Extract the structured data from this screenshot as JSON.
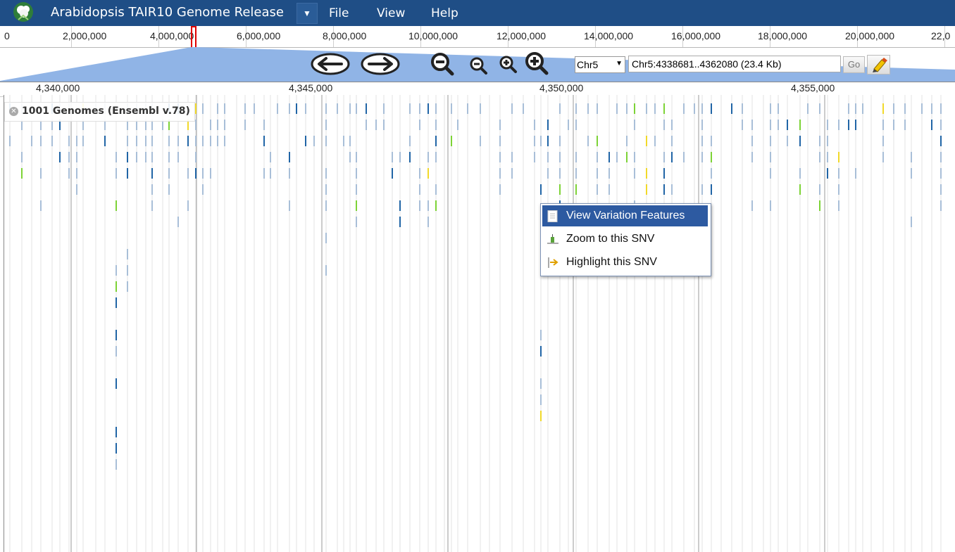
{
  "app": {
    "title": "Arabidopsis TAIR10 Genome Release",
    "menus": [
      "File",
      "View",
      "Help"
    ]
  },
  "overview": {
    "labels": [
      "0",
      "2,000,000",
      "4,000,000",
      "6,000,000",
      "8,000,000",
      "10,000,000",
      "12,000,000",
      "14,000,000",
      "16,000,000",
      "18,000,000",
      "20,000,000",
      "22,0"
    ]
  },
  "navigation": {
    "chromosome": "Chr5",
    "location": "Chr5:4338681..4362080 (23.4 Kb)",
    "go_label": "Go"
  },
  "ruler": {
    "labels": [
      "4,340,000",
      "4,345,000",
      "4,350,000",
      "4,355,000"
    ]
  },
  "track": {
    "label": "1001 Genomes (Ensembl v.78)"
  },
  "context_menu": {
    "items": [
      "View Variation Features",
      "Zoom to this SNV",
      "Highlight this SNV"
    ]
  },
  "colors": {
    "header": "#1f4e86",
    "menu_highlight": "#2d5aa1",
    "snv_blue": "#2165a6",
    "snv_light": "#a9bfd8",
    "snv_green": "#7dd337",
    "snv_yellow": "#f1d92a"
  }
}
